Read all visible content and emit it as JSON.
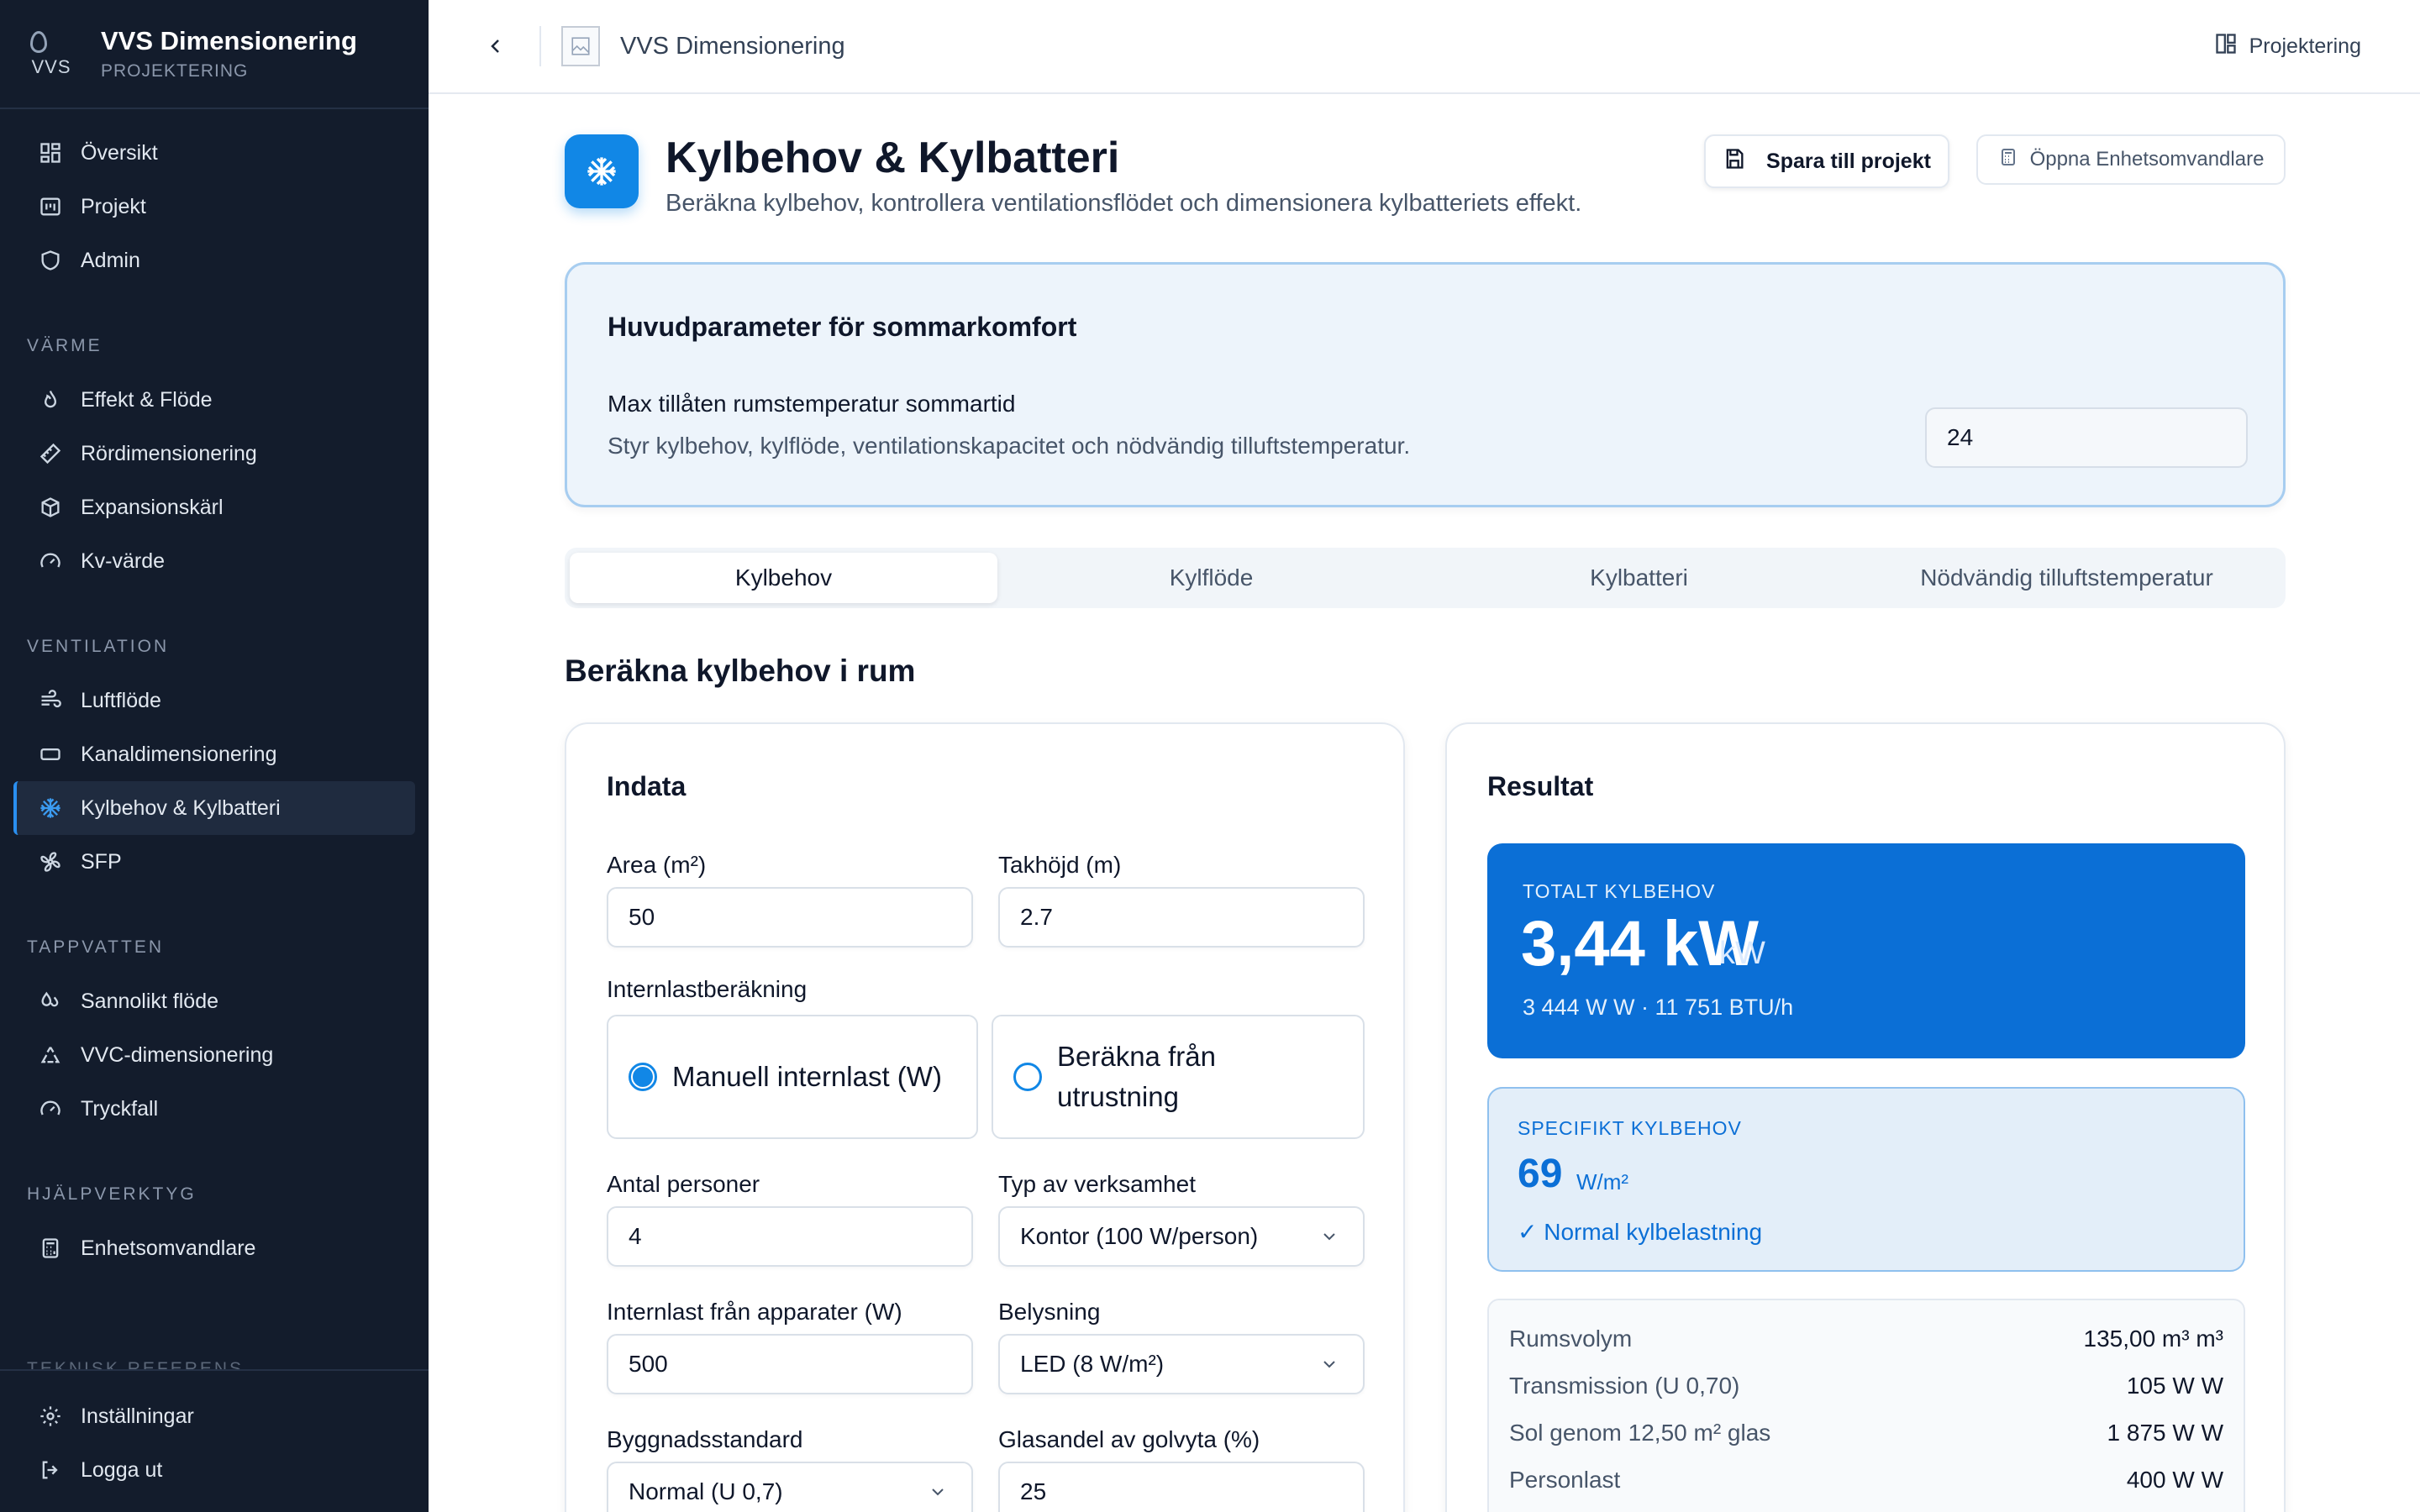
{
  "app": {
    "title": "VVS Dimensionering",
    "subtitle": "PROJEKTERING"
  },
  "sidebar": {
    "top_items": [
      {
        "label": "Översikt",
        "icon": "dashboard-icon"
      },
      {
        "label": "Projekt",
        "icon": "projects-icon"
      },
      {
        "label": "Admin",
        "icon": "shield-icon"
      }
    ],
    "groups": [
      {
        "title": "VÄRME",
        "items": [
          {
            "label": "Effekt & Flöde",
            "icon": "flame-icon"
          },
          {
            "label": "Rördimensionering",
            "icon": "ruler-icon"
          },
          {
            "label": "Expansionskärl",
            "icon": "box-icon"
          },
          {
            "label": "Kv-värde",
            "icon": "gauge-icon"
          }
        ]
      },
      {
        "title": "VENTILATION",
        "items": [
          {
            "label": "Luftflöde",
            "icon": "wind-icon"
          },
          {
            "label": "Kanaldimensionering",
            "icon": "duct-icon"
          },
          {
            "label": "Kylbehov & Kylbatteri",
            "icon": "snowflake-icon"
          },
          {
            "label": "SFP",
            "icon": "fan-icon"
          }
        ]
      },
      {
        "title": "TAPPVATTEN",
        "items": [
          {
            "label": "Sannolikt flöde",
            "icon": "droplets-icon"
          },
          {
            "label": "VVC-dimensionering",
            "icon": "recycle-icon"
          },
          {
            "label": "Tryckfall",
            "icon": "gauge-icon"
          }
        ]
      },
      {
        "title": "HJÄLPVERKTYG",
        "items": [
          {
            "label": "Enhetsomvandlare",
            "icon": "calculator-icon"
          }
        ]
      }
    ],
    "partial_group": "TEKNISK REFERENS",
    "active": "Kylbehov & Kylbatteri",
    "bottom": {
      "settings": "Inställningar",
      "logout": "Logga ut"
    }
  },
  "topbar": {
    "title": "VVS Dimensionering",
    "right_label": "Projektering"
  },
  "page": {
    "title": "Kylbehov & Kylbatteri",
    "subtitle": "Beräkna kylbehov, kontrollera ventilationsflödet och dimensionera kylbatteriets effekt.",
    "save_button": "Spara till projekt",
    "converter_button": "Öppna Enhetsomvandlare"
  },
  "params": {
    "title": "Huvudparameter för sommarkomfort",
    "label": "Max tillåten rumstemperatur sommartid",
    "help": "Styr kylbehov, kylflöde, ventilationskapacitet och nödvändig tilluftstemperatur.",
    "value": "24"
  },
  "tabs": [
    "Kylbehov",
    "Kylflöde",
    "Kylbatteri",
    "Nödvändig tilluftstemperatur"
  ],
  "active_tab": "Kylbehov",
  "section_title": "Beräkna kylbehov i rum",
  "input": {
    "title": "Indata",
    "area_label": "Area (m²)",
    "area_value": "50",
    "height_label": "Takhöjd (m)",
    "height_value": "2.7",
    "internal_label": "Internlastberäkning",
    "radio_manual": "Manuell internlast (W)",
    "radio_equipment": "Beräkna från utrustning",
    "radio_selected": "manual",
    "persons_label": "Antal personer",
    "persons_value": "4",
    "activity_label": "Typ av verksamhet",
    "activity_value": "Kontor (100 W/person)",
    "appliances_label": "Internlast från apparater (W)",
    "appliances_value": "500",
    "lighting_label": "Belysning",
    "lighting_value": "LED (8 W/m²)",
    "building_label": "Byggnadsstandard",
    "building_value": "Normal (U 0,7)",
    "glass_label": "Glasandel av golvyta (%)",
    "glass_value": "25"
  },
  "result": {
    "title": "Resultat",
    "total_label": "TOTALT KYLBEHOV",
    "total_value": "3,44 kW",
    "total_unit": "kW",
    "total_sub": "3 444 W W · 11 751 BTU/h",
    "spec_label": "SPECIFIKT KYLBEHOV",
    "spec_value": "69",
    "spec_unit": "W/m²",
    "spec_note": "✓ Normal kylbelastning",
    "rows": [
      {
        "k": "Rumsvolym",
        "v": "135,00 m³ m³"
      },
      {
        "k": "Transmission (U 0,70)",
        "v": "105 W W"
      },
      {
        "k": "Sol genom 12,50 m² glas",
        "v": "1 875 W W"
      },
      {
        "k": "Personlast",
        "v": "400 W W"
      }
    ]
  },
  "colors": {
    "accent": "#1187e6",
    "sidebar_bg": "#131c2c",
    "result_blue": "#0b6fd6"
  }
}
